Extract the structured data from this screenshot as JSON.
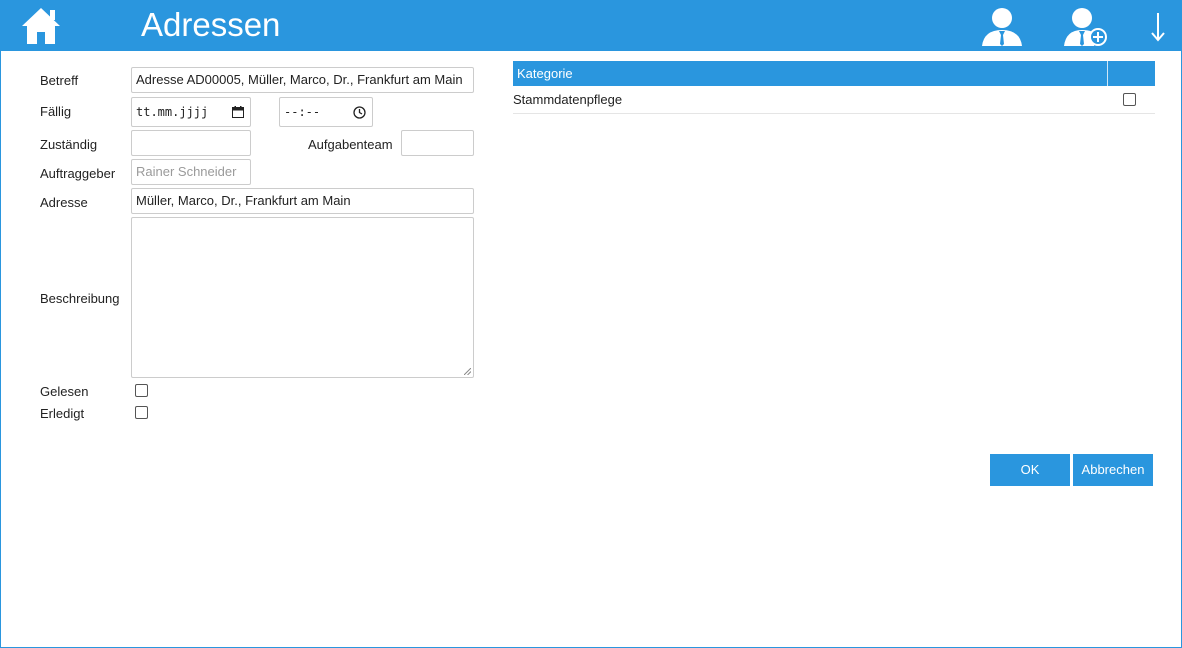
{
  "header": {
    "title": "Adressen",
    "icons": [
      "home-icon",
      "user-icon",
      "user-add-icon",
      "arrow-down-icon"
    ]
  },
  "form": {
    "betreff_label": "Betreff",
    "betreff_value": "Adresse AD00005, Müller, Marco, Dr., Frankfurt am Main",
    "faellig_label": "Fällig",
    "date_placeholder": "tt.mm.jjjj",
    "time_placeholder": "--:--",
    "zustaendig_label": "Zuständig",
    "zustaendig_value": "",
    "aufgabenteam_label": "Aufgabenteam",
    "aufgabenteam_value": "",
    "auftraggeber_label": "Auftraggeber",
    "auftraggeber_value": "Rainer Schneider",
    "adresse_label": "Adresse",
    "adresse_value": "Müller, Marco, Dr., Frankfurt am Main",
    "beschreibung_label": "Beschreibung",
    "beschreibung_value": "",
    "gelesen_label": "Gelesen",
    "gelesen_checked": false,
    "erledigt_label": "Erledigt",
    "erledigt_checked": false
  },
  "category_table": {
    "header": "Kategorie",
    "rows": [
      {
        "label": "Stammdatenpflege",
        "checked": false
      }
    ]
  },
  "buttons": {
    "ok": "OK",
    "cancel": "Abbrechen"
  },
  "colors": {
    "accent": "#2a96de",
    "text": "#222222",
    "border": "#cccccc"
  }
}
